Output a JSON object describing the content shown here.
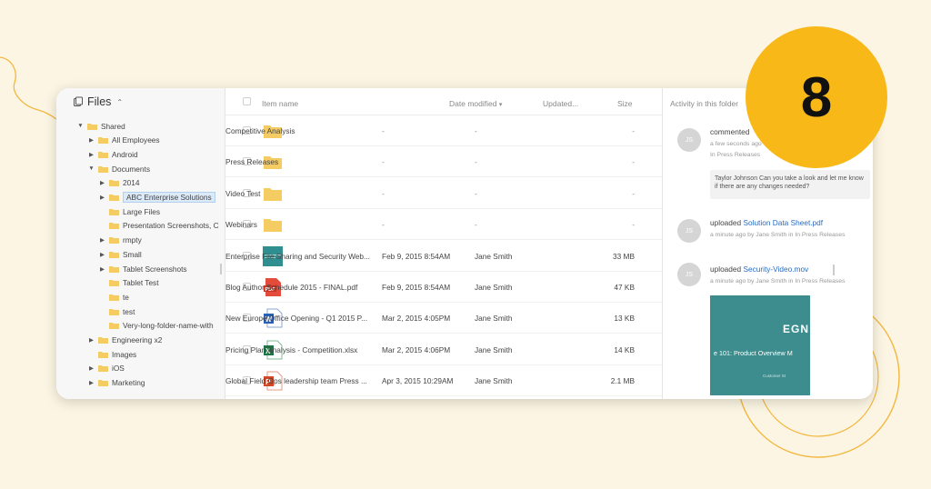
{
  "badge": {
    "number": "8"
  },
  "colors": {
    "page_bg": "#fcf5e3",
    "badge": "#f8b818",
    "folder": "#f5cc62",
    "link": "#2a6cc0",
    "decoration": "#f2b73e"
  },
  "sidebar": {
    "title": "Files",
    "tree": [
      {
        "label": "Shared",
        "arrow": "open"
      },
      {
        "label": "All Employees",
        "arrow": "closed"
      },
      {
        "label": "Android",
        "arrow": "closed"
      },
      {
        "label": "Documents",
        "arrow": "open"
      },
      {
        "label": "2014",
        "arrow": "closed"
      },
      {
        "label": "ABC Enterprise Solutions",
        "arrow": "closed",
        "selected": true
      },
      {
        "label": "Large Files",
        "arrow": "none"
      },
      {
        "label": "Presentation Screenshots, C",
        "arrow": "none"
      },
      {
        "label": "rmpty",
        "arrow": "closed"
      },
      {
        "label": "Small",
        "arrow": "closed"
      },
      {
        "label": "Tablet Screenshots",
        "arrow": "closed"
      },
      {
        "label": "Tablet Test",
        "arrow": "none"
      },
      {
        "label": "te",
        "arrow": "none"
      },
      {
        "label": "test",
        "arrow": "none"
      },
      {
        "label": "Very-long-folder-name-with",
        "arrow": "none"
      },
      {
        "label": "Engineering x2",
        "arrow": "closed"
      },
      {
        "label": "Images",
        "arrow": "none"
      },
      {
        "label": "iOS",
        "arrow": "closed"
      },
      {
        "label": "Marketing",
        "arrow": "closed"
      }
    ]
  },
  "filelist": {
    "headers": {
      "name": "Item name",
      "date": "Date modified",
      "sort": "▾",
      "updated": "Updated...",
      "size": "Size"
    },
    "rows": [
      {
        "icon": "folder",
        "name": "Competitive Analysis",
        "date": "-",
        "updated": "-",
        "size": "-"
      },
      {
        "icon": "folder",
        "name": "Press Releases",
        "date": "-",
        "updated": "-",
        "size": "-"
      },
      {
        "icon": "folder",
        "name": "Video Test",
        "date": "-",
        "updated": "-",
        "size": "-"
      },
      {
        "icon": "folder",
        "name": "Webinars",
        "date": "-",
        "updated": "-",
        "size": "-"
      },
      {
        "icon": "image",
        "name": "Enterprise File Sharing and Security Web...",
        "date": "Feb 9, 2015 8:54AM",
        "updated": "Jane Smith",
        "size": "33 MB"
      },
      {
        "icon": "pdf",
        "name": "Blog Author Schedule 2015 - FINAL.pdf",
        "date": "Feb 9, 2015 8:54AM",
        "updated": "Jane Smith",
        "size": "47 KB"
      },
      {
        "icon": "word",
        "name": "New Europe Office Opening - Q1 2015 P...",
        "date": "Mar 2, 2015 4:05PM",
        "updated": "Jane Smith",
        "size": "13 KB"
      },
      {
        "icon": "excel",
        "name": "Pricing Plan Analysis - Competition.xlsx",
        "date": "Mar 2, 2015 4:06PM",
        "updated": "Jane Smith",
        "size": "14 KB"
      },
      {
        "icon": "powerpoint",
        "name": "Global Field Ops leadership team Press ...",
        "date": "Apr 3, 2015 10:29AM",
        "updated": "Jane Smith",
        "size": "2.1 MB"
      }
    ]
  },
  "activity": {
    "title": "Activity in this folder",
    "items": [
      {
        "avatar": "JS",
        "action": "commented",
        "target": "",
        "sub1": "a few seconds ago",
        "sub2": "In Press Releases",
        "comment": "Taylor Johnson Can you take a look and let me know if there are any changes needed?"
      },
      {
        "avatar": "JS",
        "action": "uploaded ",
        "target": "Solution Data Sheet.pdf",
        "sub1": "a minute ago by Jane Smith in In Press Releases"
      },
      {
        "avatar": "JS",
        "action": "uploaded ",
        "target": "Security-Video.mov",
        "sub1": "a minute ago by Jane Smith in In Press Releases"
      }
    ],
    "video": {
      "title": "EGN",
      "subtitle": "e 101: Product Overview M",
      "caption": "Customer St"
    }
  }
}
